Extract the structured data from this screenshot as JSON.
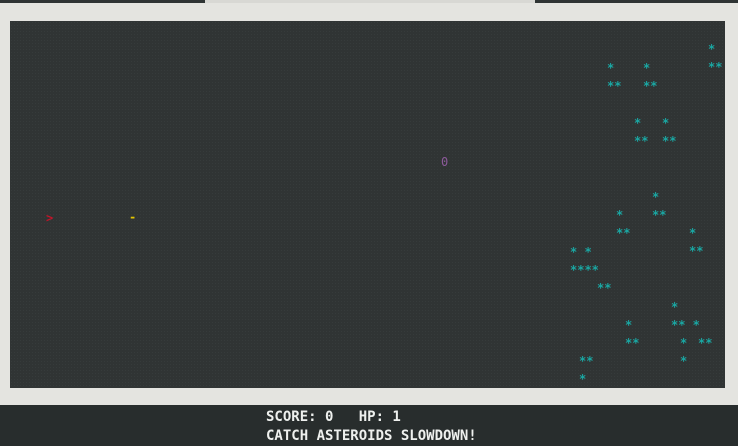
{
  "window": {
    "accent": "#2f3434"
  },
  "game": {
    "background": "#303434",
    "player": {
      "glyph": ">",
      "color": "#c0152a"
    },
    "bullet": {
      "glyph": "-",
      "color": "#e2c400"
    },
    "enemy": {
      "glyph": "0",
      "color": "#8c5a9a"
    },
    "asteroid_color": "#1aa7a3",
    "asteroids": [
      {
        "glyph": "*",
        "icon": "asteroid-star-icon"
      },
      {
        "glyph": "**",
        "icon": "asteroid-star-icon"
      },
      {
        "glyph": "*",
        "icon": "asteroid-star-icon"
      },
      {
        "glyph": "**",
        "icon": "asteroid-star-icon"
      },
      {
        "glyph": "*",
        "icon": "asteroid-star-icon"
      },
      {
        "glyph": "**",
        "icon": "asteroid-star-icon"
      },
      {
        "glyph": "*",
        "icon": "asteroid-star-icon"
      },
      {
        "glyph": "**",
        "icon": "asteroid-star-icon"
      },
      {
        "glyph": "*",
        "icon": "asteroid-star-icon"
      },
      {
        "glyph": "**",
        "icon": "asteroid-star-icon"
      },
      {
        "glyph": "*",
        "icon": "asteroid-star-icon"
      },
      {
        "glyph": "**",
        "icon": "asteroid-star-icon"
      },
      {
        "glyph": "*",
        "icon": "asteroid-star-icon"
      },
      {
        "glyph": "**",
        "icon": "asteroid-star-icon"
      },
      {
        "glyph": "*",
        "icon": "asteroid-star-icon"
      },
      {
        "glyph": "**",
        "icon": "asteroid-star-icon"
      },
      {
        "glyph": "* *",
        "icon": "asteroid-star-icon"
      },
      {
        "glyph": "****",
        "icon": "asteroid-star-icon"
      },
      {
        "glyph": "**",
        "icon": "asteroid-star-icon"
      },
      {
        "glyph": "*",
        "icon": "asteroid-star-icon"
      },
      {
        "glyph": "** *",
        "icon": "asteroid-star-icon"
      },
      {
        "glyph": "*",
        "icon": "asteroid-star-icon"
      },
      {
        "glyph": "**",
        "icon": "asteroid-star-icon"
      },
      {
        "glyph": "*",
        "icon": "asteroid-star-icon"
      },
      {
        "glyph": "**",
        "icon": "asteroid-star-icon"
      },
      {
        "glyph": "*",
        "icon": "asteroid-star-icon"
      },
      {
        "glyph": "**",
        "icon": "asteroid-star-icon"
      },
      {
        "glyph": "*",
        "icon": "asteroid-star-icon"
      },
      {
        "glyph": "**",
        "icon": "asteroid-star-icon"
      }
    ]
  },
  "hud": {
    "score_line": "SCORE: 0   HP: 1",
    "message": "CATCH ASTEROIDS SLOWDOWN!"
  }
}
